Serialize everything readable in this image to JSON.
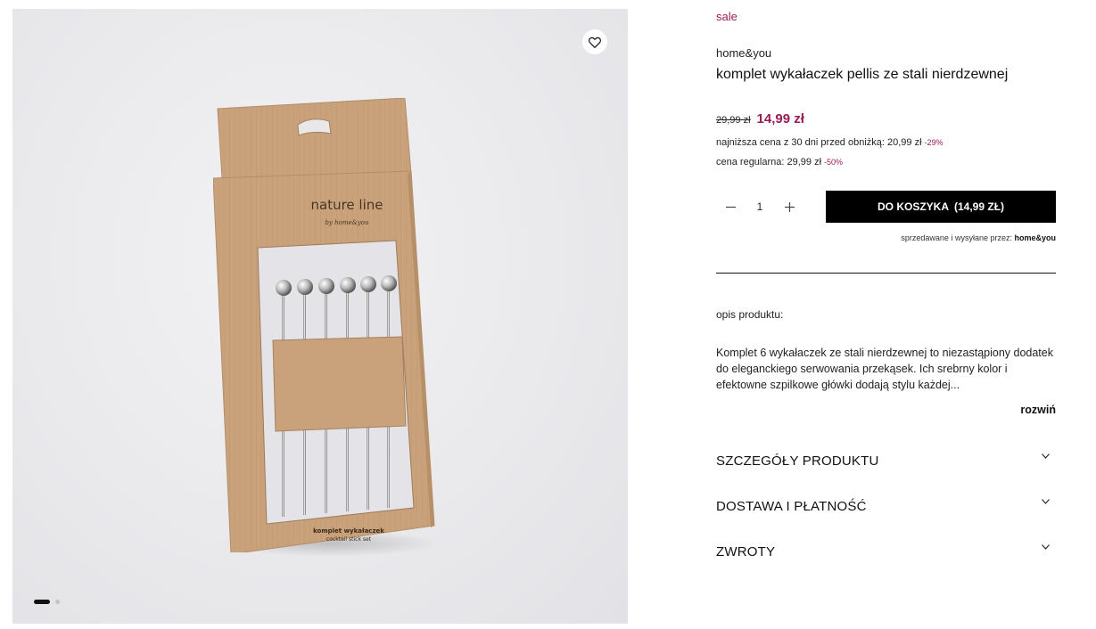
{
  "gallery": {
    "box_text": {
      "brand_line": "nature line",
      "brand_sub": "by home&you",
      "product_line": "komplet wykałaczek",
      "product_sub": "cocktail stick set"
    },
    "slides_total": 2,
    "active_slide": 1,
    "favorite_icon": "heart-icon"
  },
  "product": {
    "badge": "sale",
    "brand": "home&you",
    "title": "komplet wykałaczek pellis ze stali nierdzewnej",
    "old_price": "29,99 zł",
    "new_price": "14,99 zł",
    "lowest_price_label": "najniższa cena z 30 dni przed obniżką: 20,99 zł",
    "lowest_price_pct": "-29%",
    "regular_price_label": "cena regularna: 29,99 zł",
    "regular_price_pct": "-50%"
  },
  "cart": {
    "quantity": "1",
    "minus_icon": "minus-icon",
    "plus_icon": "plus-icon",
    "button_label": "DO KOSZYKA",
    "button_price": "(14,99 ZŁ)",
    "seller_label": "sprzedawane i wysyłane przez:",
    "seller_name": "home&you"
  },
  "description": {
    "heading": "opis produktu:",
    "text": "Komplet 6 wykałaczek ze stali nierdzewnej to niezastąpiony dodatek do eleganckiego serwowania przekąsek. Ich srebrny kolor i efektowne szpilkowe główki dodają stylu każdej...",
    "more_label": "rozwiń"
  },
  "accordions": [
    {
      "label": "SZCZEGÓŁY PRODUKTU"
    },
    {
      "label": "DOSTAWA I PŁATNOŚĆ"
    },
    {
      "label": "ZWROTY"
    }
  ],
  "colors": {
    "accent": "#9b1b55",
    "cart_button": "#000000",
    "cardboard": "#c9a27c"
  }
}
